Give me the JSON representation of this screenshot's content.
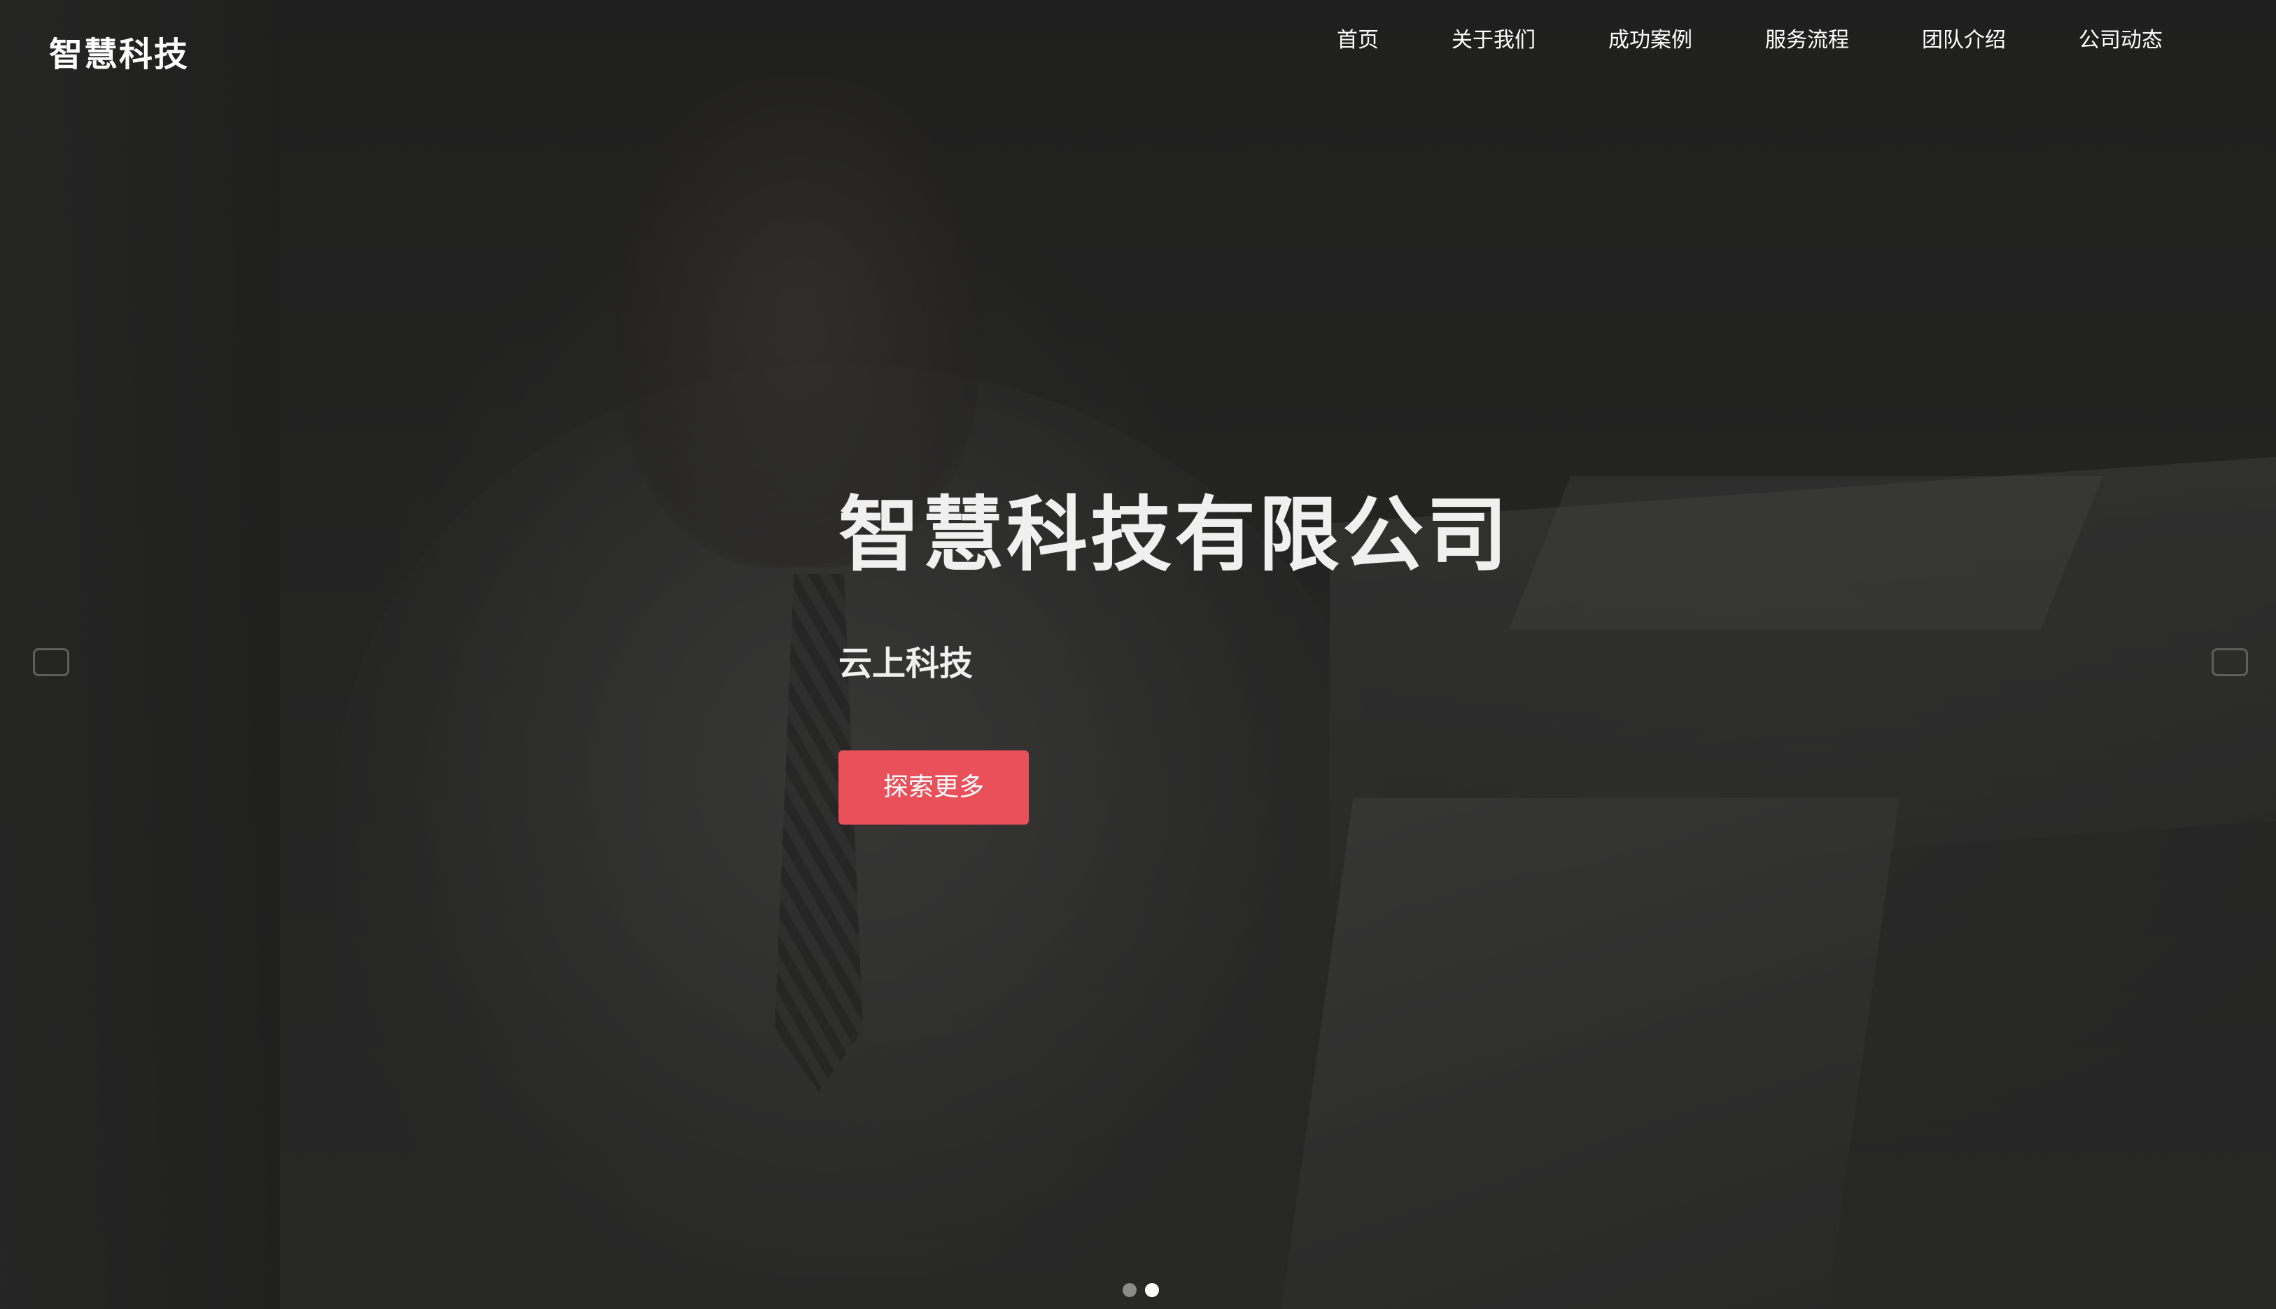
{
  "header": {
    "logo": "智慧科技",
    "nav": [
      {
        "label": "首页"
      },
      {
        "label": "关于我们"
      },
      {
        "label": "成功案例"
      },
      {
        "label": "服务流程"
      },
      {
        "label": "团队介绍"
      },
      {
        "label": "公司动态"
      }
    ]
  },
  "hero": {
    "title": "智慧科技有限公司",
    "subtitle": "云上科技",
    "cta_label": "探索更多",
    "cta_color": "#e9505a"
  },
  "carousel": {
    "prev_icon": "arrow-left-icon",
    "next_icon": "arrow-right-icon",
    "slide_count": 2,
    "active_slide": 2
  }
}
